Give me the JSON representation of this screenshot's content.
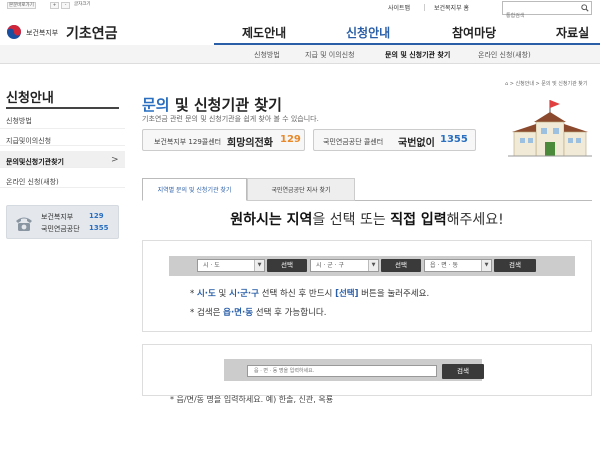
{
  "util": {
    "home_label": "본문바로가기",
    "plus": "+",
    "minus": "-",
    "zoom_label": "글자크기"
  },
  "toplinks": {
    "sitemap": "사이트맵",
    "ministry_home": "보건복지부 홈"
  },
  "search": {
    "placeholder": "통합검색"
  },
  "brand": {
    "ministry": "보건복지부",
    "name": "기초연금"
  },
  "gnb": [
    "제도안내",
    "신청안내",
    "참여마당",
    "자료실"
  ],
  "subnav": [
    "신청방법",
    "지급 및 이의신청",
    "문의 및 신청기관 찾기",
    "온라인 신청(새창)"
  ],
  "lnb": {
    "title": "신청안내",
    "items": [
      "신청방법",
      "지급및이의신청",
      "문의및신청기관찾기",
      "온라인 신청(새창)"
    ],
    "arrow": ">"
  },
  "callbox": {
    "line1_label": "보건복지부",
    "line1_num": "129",
    "line2_label": "국민연금공단",
    "line2_num": "1355"
  },
  "breadcrumb": "⌂ > 신청안내 > 문의 및 신청기관 찾기",
  "page": {
    "title_part1": "문의",
    "title_part2": "및 신청기관 찾기",
    "desc": "기초연금 관련 문의 및 신청기관을 쉽게 찾아 볼 수 있습니다."
  },
  "contacts": [
    {
      "label": "보건복지부 129콜센터",
      "name": "희망의전화",
      "num": "129"
    },
    {
      "label": "국민연금공단 콜센터",
      "name": "국번없이",
      "num": "1355"
    }
  ],
  "tabs": [
    "지역별 문의 및 신청기관 찾기",
    "국민연금공단 지사 찾기"
  ],
  "headline": {
    "p1": "원하시는 지역",
    "p2": "을 선택 또는 ",
    "p3": "직접 입력",
    "p4": "해주세요!"
  },
  "selects": {
    "sido": "시 · 도",
    "sigungu": "시 · 군 · 구",
    "eupmyeondong": "읍 · 면 · 동",
    "arrow": "▼"
  },
  "buttons": {
    "select": "선택",
    "search": "검색"
  },
  "notes": {
    "n1_a": "* ",
    "n1_k1": "시·도",
    "n1_b": " 및 ",
    "n1_k2": "시·군·구",
    "n1_c": " 선택 하신 후 반드시 ",
    "n1_k3": "[선택]",
    "n1_d": " 버튼을 눌러주세요.",
    "n2_a": "* 검색은 ",
    "n2_k": "읍·면·동",
    "n2_b": " 선택 후 가능합니다."
  },
  "text_search": {
    "placeholder": "읍 · 면 · 동 명을 입력하세요.",
    "note": "* 읍/면/동 명을 입력하세요. 예) 한솔, 신관, 옥룡"
  },
  "colors": {
    "accent": "#2a5fa8",
    "num_orange": "#e8892a",
    "num_blue": "#2a6fc0"
  }
}
